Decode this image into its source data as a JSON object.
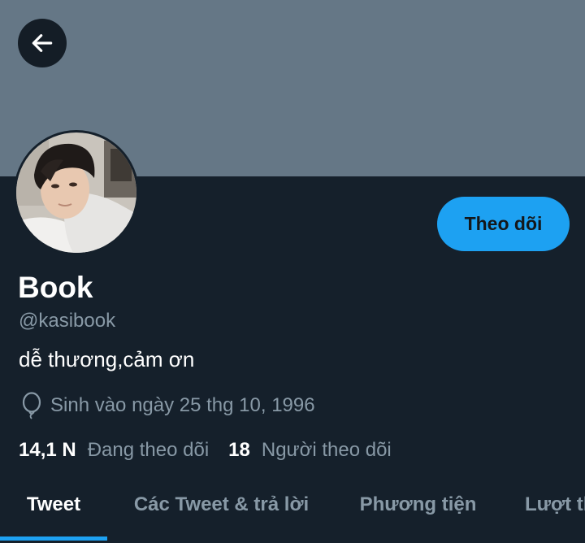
{
  "colors": {
    "background": "#15202b",
    "banner": "#657786",
    "accent": "#1da1f2",
    "text_primary": "#ffffff",
    "text_secondary": "#8899a6"
  },
  "header": {
    "back_icon": "arrow-left-icon"
  },
  "profile": {
    "name": "Book",
    "handle": "@kasibook",
    "bio": "dễ thương,cảm ơn",
    "birthday_icon": "balloon-icon",
    "birthday": "Sinh vào ngày 25 thg 10, 1996",
    "follow_label": "Theo dõi",
    "following_count": "14,1 N",
    "following_label": "Đang theo dõi",
    "followers_count": "18",
    "followers_label": "Người theo dõi"
  },
  "tabs": [
    {
      "label": "Tweet",
      "active": true
    },
    {
      "label": "Các Tweet & trả lời",
      "active": false
    },
    {
      "label": "Phương tiện",
      "active": false
    },
    {
      "label": "Lượt thích",
      "active": false
    }
  ]
}
